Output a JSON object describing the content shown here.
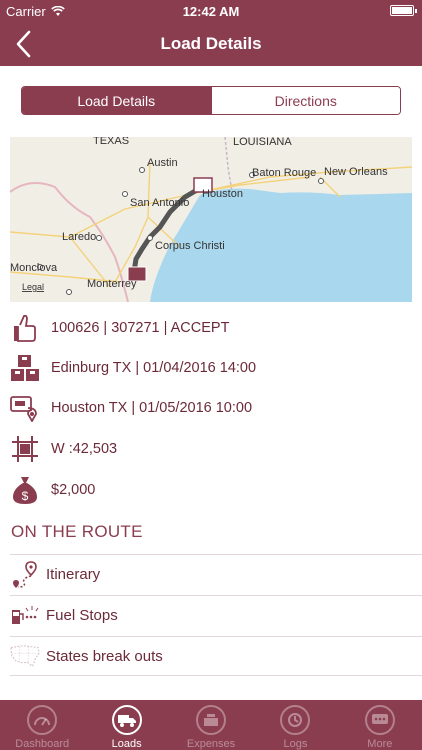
{
  "status_bar": {
    "carrier": "Carrier",
    "time": "12:42 AM",
    "battery_level": 1.0
  },
  "nav": {
    "title": "Load Details",
    "back_icon": "chevron-left-icon"
  },
  "segments": [
    {
      "label": "Load Details",
      "active": true
    },
    {
      "label": "Directions",
      "active": false
    }
  ],
  "map": {
    "labels": {
      "texas": "TEXAS",
      "louisiana": "LOUISIANA",
      "austin": "Austin",
      "baton_rouge": "Baton Rouge",
      "new_orleans": "New Orleans",
      "san_antonio": "San Antonio",
      "houston": "Houston",
      "laredo": "Laredo",
      "corpus_christi": "Corpus Christi",
      "monclova": "Monclova",
      "monterrey": "Monterrey",
      "legal": "Legal"
    }
  },
  "details": {
    "load_ref": "100626 | 307271 | ACCEPT",
    "pickup": "Edinburg TX | 01/04/2016 14:00",
    "delivery": "Houston TX | 01/05/2016 10:00",
    "weight": "W :42,503",
    "rate": "$2,000"
  },
  "route_section": {
    "header": "ON THE ROUTE",
    "items": [
      {
        "label": "Itinerary",
        "icon": "route-pin-icon"
      },
      {
        "label": "Fuel Stops",
        "icon": "fuel-pump-icon"
      },
      {
        "label": "States break outs",
        "icon": "us-map-icon"
      }
    ]
  },
  "tabs": [
    {
      "label": "Dashboard",
      "icon": "speedometer-icon",
      "active": false
    },
    {
      "label": "Loads",
      "icon": "truck-icon",
      "active": true
    },
    {
      "label": "Expenses",
      "icon": "cash-register-icon",
      "active": false
    },
    {
      "label": "Logs",
      "icon": "log-icon",
      "active": false
    },
    {
      "label": "More",
      "icon": "more-icon",
      "active": false
    }
  ],
  "colors": {
    "brand": "#8b3d50",
    "text": "#6b2a3a",
    "water": "#a9d8ee",
    "land": "#f1eee6"
  }
}
